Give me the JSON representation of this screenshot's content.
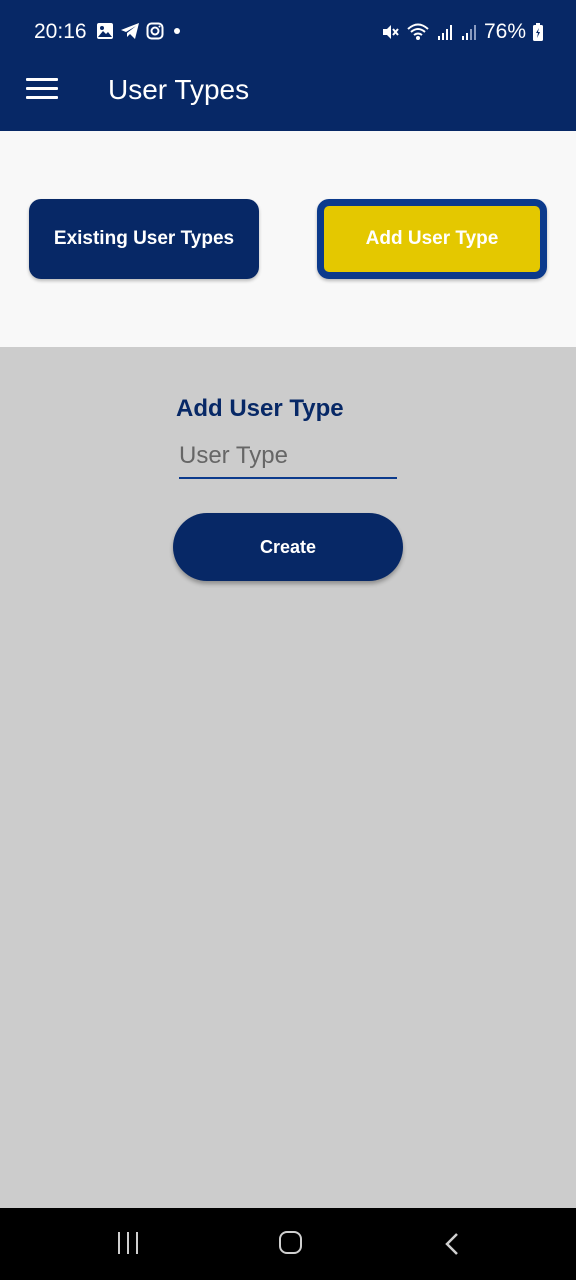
{
  "status_bar": {
    "time": "20:16",
    "battery_percent": "76%",
    "left_icons": [
      "gallery-icon",
      "telegram-icon",
      "instagram-icon",
      "dot-icon"
    ],
    "right_icons": [
      "mute-icon",
      "wifi-icon",
      "signal-icon",
      "signal-icon-2",
      "battery-icon"
    ]
  },
  "app_bar": {
    "title": "User Types",
    "menu_icon": "hamburger-menu-icon"
  },
  "tabs": {
    "existing_label": "Existing User Types",
    "add_label": "Add User Type",
    "active": "add"
  },
  "form": {
    "title": "Add User Type",
    "user_type_placeholder": "User Type",
    "user_type_value": "",
    "create_label": "Create"
  },
  "colors": {
    "primary": "#072866",
    "accent": "#e4c800",
    "content_bg": "#cccccc",
    "tabs_bg": "#f8f8f8"
  },
  "nav_bar": {
    "recents_icon": "recents-icon",
    "home_icon": "home-icon",
    "back_icon": "back-icon"
  }
}
